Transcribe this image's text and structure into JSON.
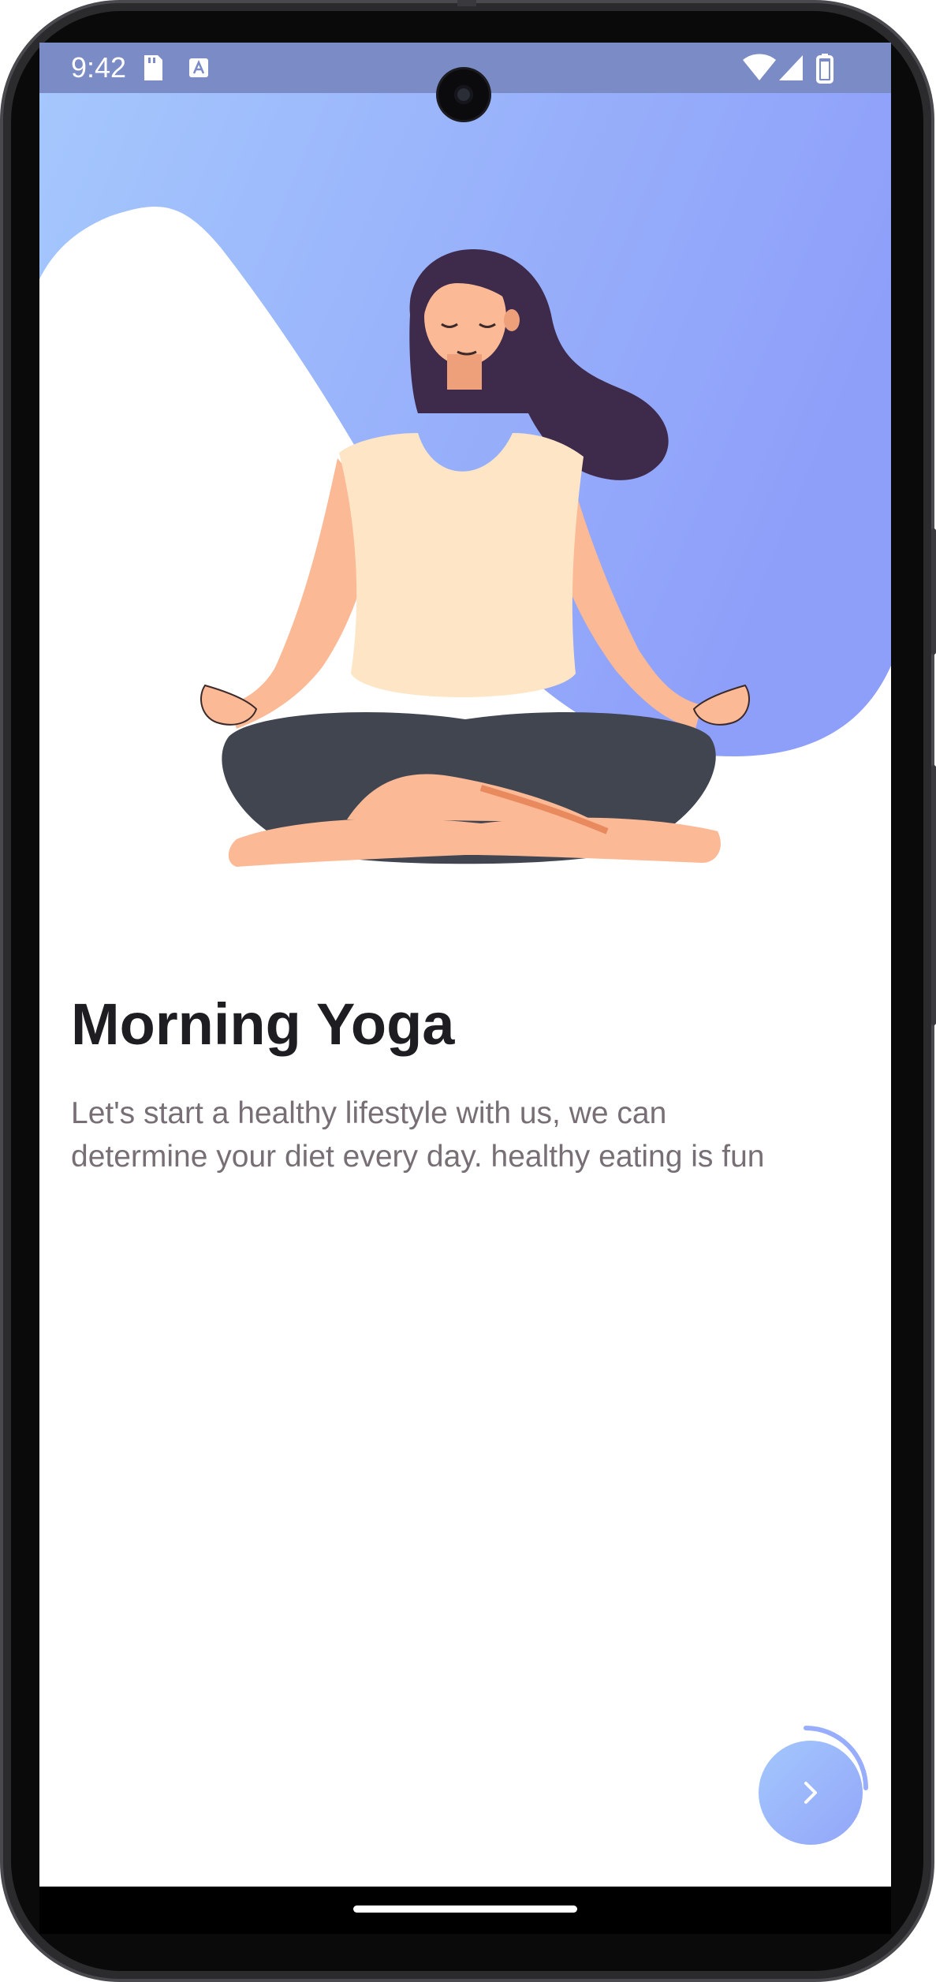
{
  "status_bar": {
    "time": "9:42",
    "left_icons": [
      "sd-card-icon",
      "keyboard-a-icon"
    ],
    "right_icons": [
      "wifi-icon",
      "cell-signal-icon",
      "battery-icon"
    ]
  },
  "onboarding": {
    "illustration": "meditating-woman-illustration",
    "title": "Morning Yoga",
    "description": "Let's start a healthy lifestyle with us, we can determine your diet every day. healthy eating is fun",
    "next_button_icon": "chevron-right-icon",
    "progress": 0.25
  },
  "colors": {
    "gradient_start": "#a5c8fd",
    "gradient_end": "#8e9ff9",
    "title": "#1d1d22",
    "body_text": "#776f75",
    "status_bar": "#7b8bc6"
  }
}
